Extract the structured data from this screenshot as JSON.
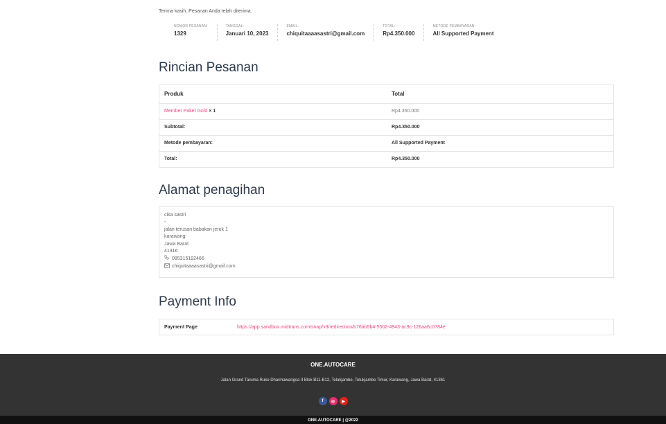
{
  "thanks_message": "Terima kasih. Pesanan Anda telah diterima.",
  "overview": [
    {
      "label": "NOMOR PESANAN:",
      "value": "1329"
    },
    {
      "label": "TANGGAL:",
      "value": "Januari 10, 2023"
    },
    {
      "label": "EMAIL:",
      "value": "chiquitaaaasastri@gmail.com"
    },
    {
      "label": "TOTAL:",
      "value": "Rp4.350.000"
    },
    {
      "label": "METODE PEMBAYARAN:",
      "value": "All Supported Payment"
    }
  ],
  "order_details": {
    "title": "Rincian Pesanan",
    "header_product": "Produk",
    "header_total": "Total",
    "product_name": "Member Paket Gold",
    "product_qty": " × 1",
    "product_total": "Rp4.350.000",
    "rows": [
      {
        "label": "Subtotal:",
        "value": "Rp4.350.000"
      },
      {
        "label": "Metode pembayaran:",
        "value": "All Supported Payment"
      },
      {
        "label": "Total:",
        "value": "Rp4.350.000"
      }
    ]
  },
  "billing": {
    "title": "Alamat penagihan",
    "name": "cika sastri",
    "company": "-",
    "street": "jalan terusan babakan jeruk 1",
    "city": "karawang",
    "state": "Jawa Barat",
    "postcode": "41316",
    "phone": "085315192466",
    "email": "chiquitaaaasastri@gmail.com",
    "phone_icon": "phone-icon",
    "email_icon": "envelope-icon"
  },
  "payment_info": {
    "title": "Payment Info",
    "label": "Payment Page",
    "url": "https://app.sandbox.midtrans.com/snap/v3/redirection/b76ab5b4-5502-4943-ac9c-126aa6c0784e"
  },
  "footer": {
    "brand": "ONE.AUTOCARE",
    "address": "Jalan Grand Taruma Ruko Dharmawangsa II Blok B11-B12, Telukjambe, Telukjambe Timur, Karawang, Jawa Barat, 41361",
    "socials": [
      {
        "icon": "facebook-icon",
        "glyph": "f",
        "color": "#3b5998"
      },
      {
        "icon": "instagram-icon",
        "glyph": "◎",
        "color": "#e1306c"
      },
      {
        "icon": "youtube-icon",
        "glyph": "▶",
        "color": "#e62117"
      }
    ],
    "copyright": "ONE.AUTOCARE | @2022"
  }
}
